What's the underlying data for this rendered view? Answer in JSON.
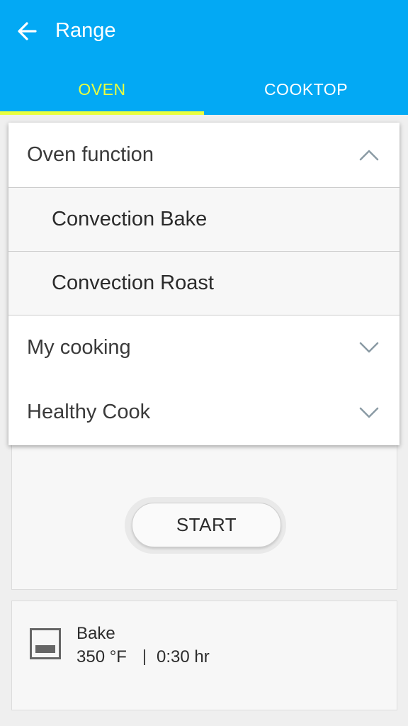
{
  "appbar": {
    "title": "Range",
    "back_icon": "arrow-left-icon"
  },
  "tabs": [
    {
      "label": "OVEN",
      "selected": true
    },
    {
      "label": "COOKTOP",
      "selected": false
    }
  ],
  "dropdown": {
    "sections": [
      {
        "label": "Oven function",
        "expanded": true,
        "options": [
          "Convection Bake",
          "Convection Roast"
        ]
      },
      {
        "label": "My cooking",
        "expanded": false
      },
      {
        "label": "Healthy Cook",
        "expanded": false
      }
    ]
  },
  "controls": {
    "start_label": "START"
  },
  "status": {
    "mode": "Bake",
    "temperature": "350 °F",
    "time": "0:30 hr",
    "icon": "oven-icon"
  },
  "colors": {
    "accent": "#03a9f4",
    "tab_highlight": "#e9ff3f"
  }
}
